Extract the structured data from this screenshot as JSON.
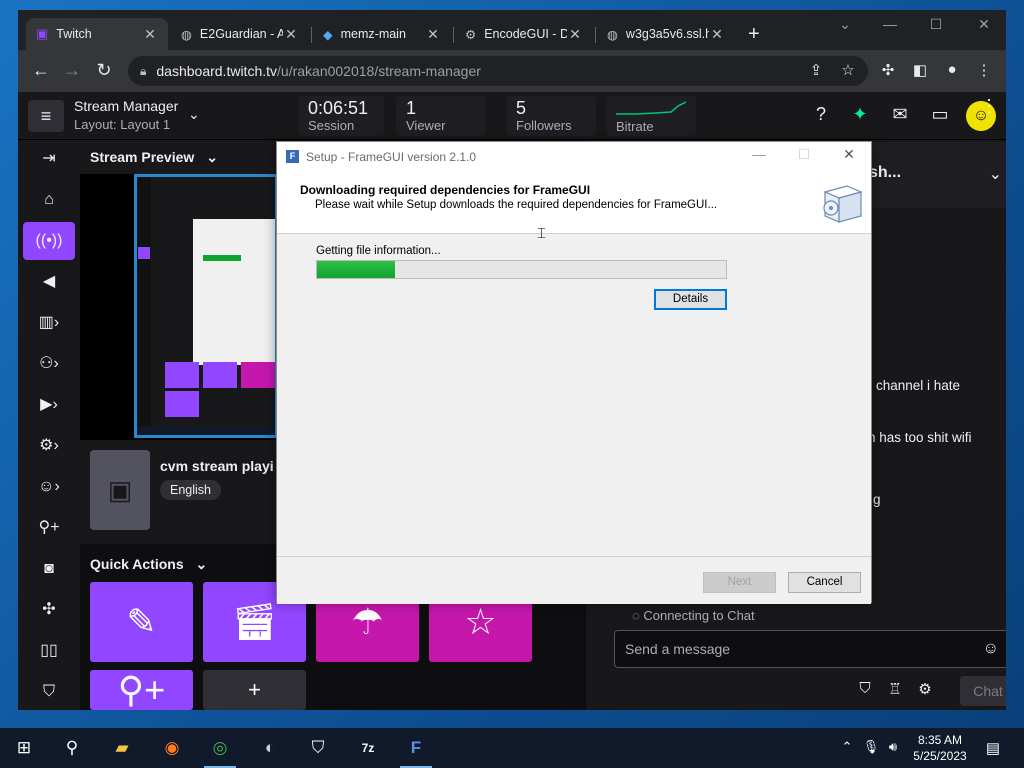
{
  "browser": {
    "tabs": [
      {
        "title": "Twitch",
        "icon": "twitch-icon"
      },
      {
        "title": "E2Guardian - A",
        "icon": "globe-icon"
      },
      {
        "title": "memz-main",
        "icon": "replit-icon"
      },
      {
        "title": "EncodeGUI - D",
        "icon": "gear-icon"
      },
      {
        "title": "w3g3a5v6.ssl.h",
        "icon": "globe-icon"
      }
    ],
    "new_tab": "+",
    "url_host": "dashboard.twitch.tv",
    "url_path": "/u/rakan002018/stream-manager"
  },
  "twitch": {
    "header": {
      "title": "Stream Manager",
      "layout": "Layout: Layout 1",
      "stats": [
        {
          "value": "0:06:51",
          "label": "Session"
        },
        {
          "value": "1",
          "label": "Viewer"
        },
        {
          "value": "5",
          "label": "Followers"
        },
        {
          "value": "",
          "label": "Bitrate"
        }
      ]
    },
    "stream_preview_label": "Stream Preview",
    "stream_info": {
      "title": "cvm stream playi",
      "tag": "English"
    },
    "quick_actions_label": "Quick Actions",
    "quick_actions": [
      {
        "icon": "pencil-icon",
        "color": "#9147ff"
      },
      {
        "icon": "clapper-icon",
        "color": "#9147ff"
      },
      {
        "icon": "parachute-icon",
        "color": "#c617ad"
      },
      {
        "icon": "star-icon",
        "color": "#c617ad"
      },
      {
        "icon": "add-user-icon",
        "color": "#9147ff"
      },
      {
        "icon": "plus-icon",
        "color": "#2f2f35"
      }
    ],
    "chat": {
      "card_title": "sh...",
      "messages": [
        "channel i hate",
        "n has too shit wifi",
        "g"
      ],
      "connecting": "Connecting to Chat",
      "input_placeholder": "Send a message",
      "chat_button": "Chat"
    }
  },
  "setup_dialog": {
    "title": "Setup - FrameGUI version 2.1.0",
    "heading": "Downloading required dependencies for FrameGUI",
    "subheading": "Please wait while Setup downloads the required dependencies for FrameGUI...",
    "status": "Getting file information...",
    "progress": 0.19,
    "details_button": "Details",
    "next_button": "Next",
    "cancel_button": "Cancel"
  },
  "taskbar": {
    "time": "8:35 AM",
    "date": "5/25/2023"
  },
  "colors": {
    "twitch_purple": "#9147ff",
    "magenta": "#c617ad",
    "progress_green": "#11a32e",
    "focus_blue": "#0078d7"
  }
}
